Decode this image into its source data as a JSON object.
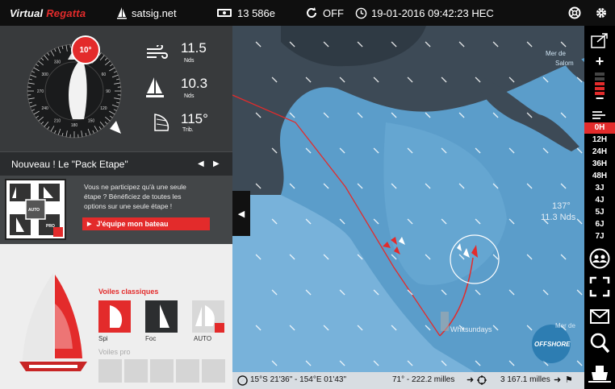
{
  "topbar": {
    "logo_main": "Virtual",
    "logo_accent": "Regatta",
    "site": "satsig.net",
    "credits": "13 586e",
    "sync_state": "OFF",
    "datetime": "19-01-2016 09:42:23 HEC"
  },
  "instruments": {
    "heading_badge": "10°",
    "wind_speed": "11.5",
    "wind_speed_unit": "Nds",
    "boat_speed": "10.3",
    "boat_speed_unit": "Nds",
    "twa": "115°",
    "twa_unit": "Trib.",
    "compass_labels": [
      "210",
      "220",
      "230",
      "240",
      "250",
      "260",
      "270",
      "280",
      "290",
      "300",
      "310",
      "320",
      "330",
      "340",
      "350",
      "0",
      "10",
      "20",
      "30",
      "40",
      "50",
      "60",
      "70",
      "80",
      "90",
      "100",
      "110",
      "120",
      "130",
      "140",
      "150",
      "160",
      "170",
      "180",
      "190",
      "200"
    ]
  },
  "promo": {
    "title": "Nouveau ! Le \"Pack Etape\"",
    "text1": "Vous ne participez qu'à une seule",
    "text2": "étape ? Bénéficiez de toutes les",
    "text3": "options sur une seule étape !",
    "button": "J'équipe mon bateau",
    "icon_badge_auto": "AUTO",
    "icon_badge_pro": "PRO"
  },
  "sails": {
    "classic_title": "Voiles classiques",
    "spi": "Spi",
    "foc": "Foc",
    "auto": "AUTO",
    "pro_title": "Voiles pro"
  },
  "map": {
    "labels": {
      "mer_top": "Mer de",
      "mer_top2": "Salom",
      "mer_mid": "Mer de",
      "whitsundays": "Whitsundays",
      "offshore": "OFFSHORE"
    },
    "wind_dir": "137°",
    "wind_speed": "11.3 Nds"
  },
  "bottombar": {
    "position": "15°S 21'36\" - 154°E 01'43\"",
    "route": "71° - 222.2 milles",
    "distance": "3 167.1 milles"
  },
  "rightbar": {
    "time_steps": [
      "0H",
      "12H",
      "24H",
      "36H",
      "48H",
      "3J",
      "4J",
      "5J",
      "6J",
      "7J"
    ]
  },
  "colors": {
    "accent": "#e32b2b",
    "map_sea": "#5a9cc9",
    "land": "#3f4a55"
  }
}
